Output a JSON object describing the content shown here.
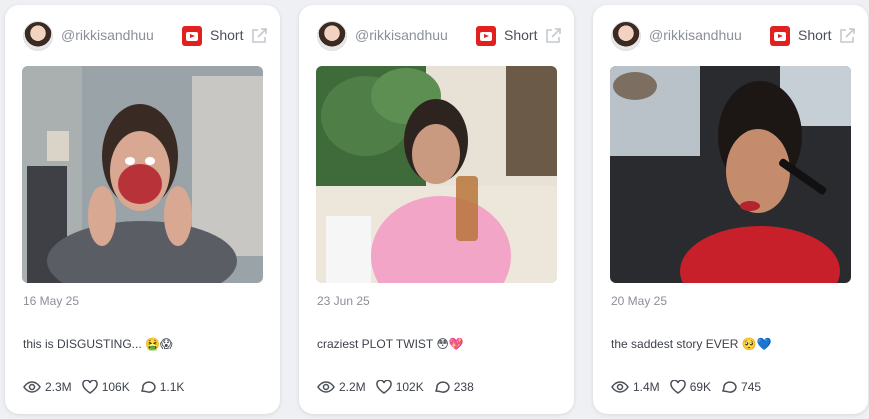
{
  "cards": [
    {
      "handle": "@rikkisandhuu",
      "type": "Short",
      "date": "16 May 25",
      "caption": "this is DISGUSTING... 🤮😱",
      "views": "2.3M",
      "likes": "106K",
      "comments": "1.1K"
    },
    {
      "handle": "@rikkisandhuu",
      "type": "Short",
      "date": "23 Jun 25",
      "caption": "craziest PLOT TWIST 😳💖",
      "views": "2.2M",
      "likes": "102K",
      "comments": "238"
    },
    {
      "handle": "@rikkisandhuu",
      "type": "Short",
      "date": "20 May 25",
      "caption": "the saddest story EVER 🥺💙",
      "views": "1.4M",
      "likes": "69K",
      "comments": "745"
    }
  ],
  "colors": {
    "youtube_red": "#e32020",
    "text_muted": "#8a8f99",
    "text_main": "#3d424b"
  }
}
